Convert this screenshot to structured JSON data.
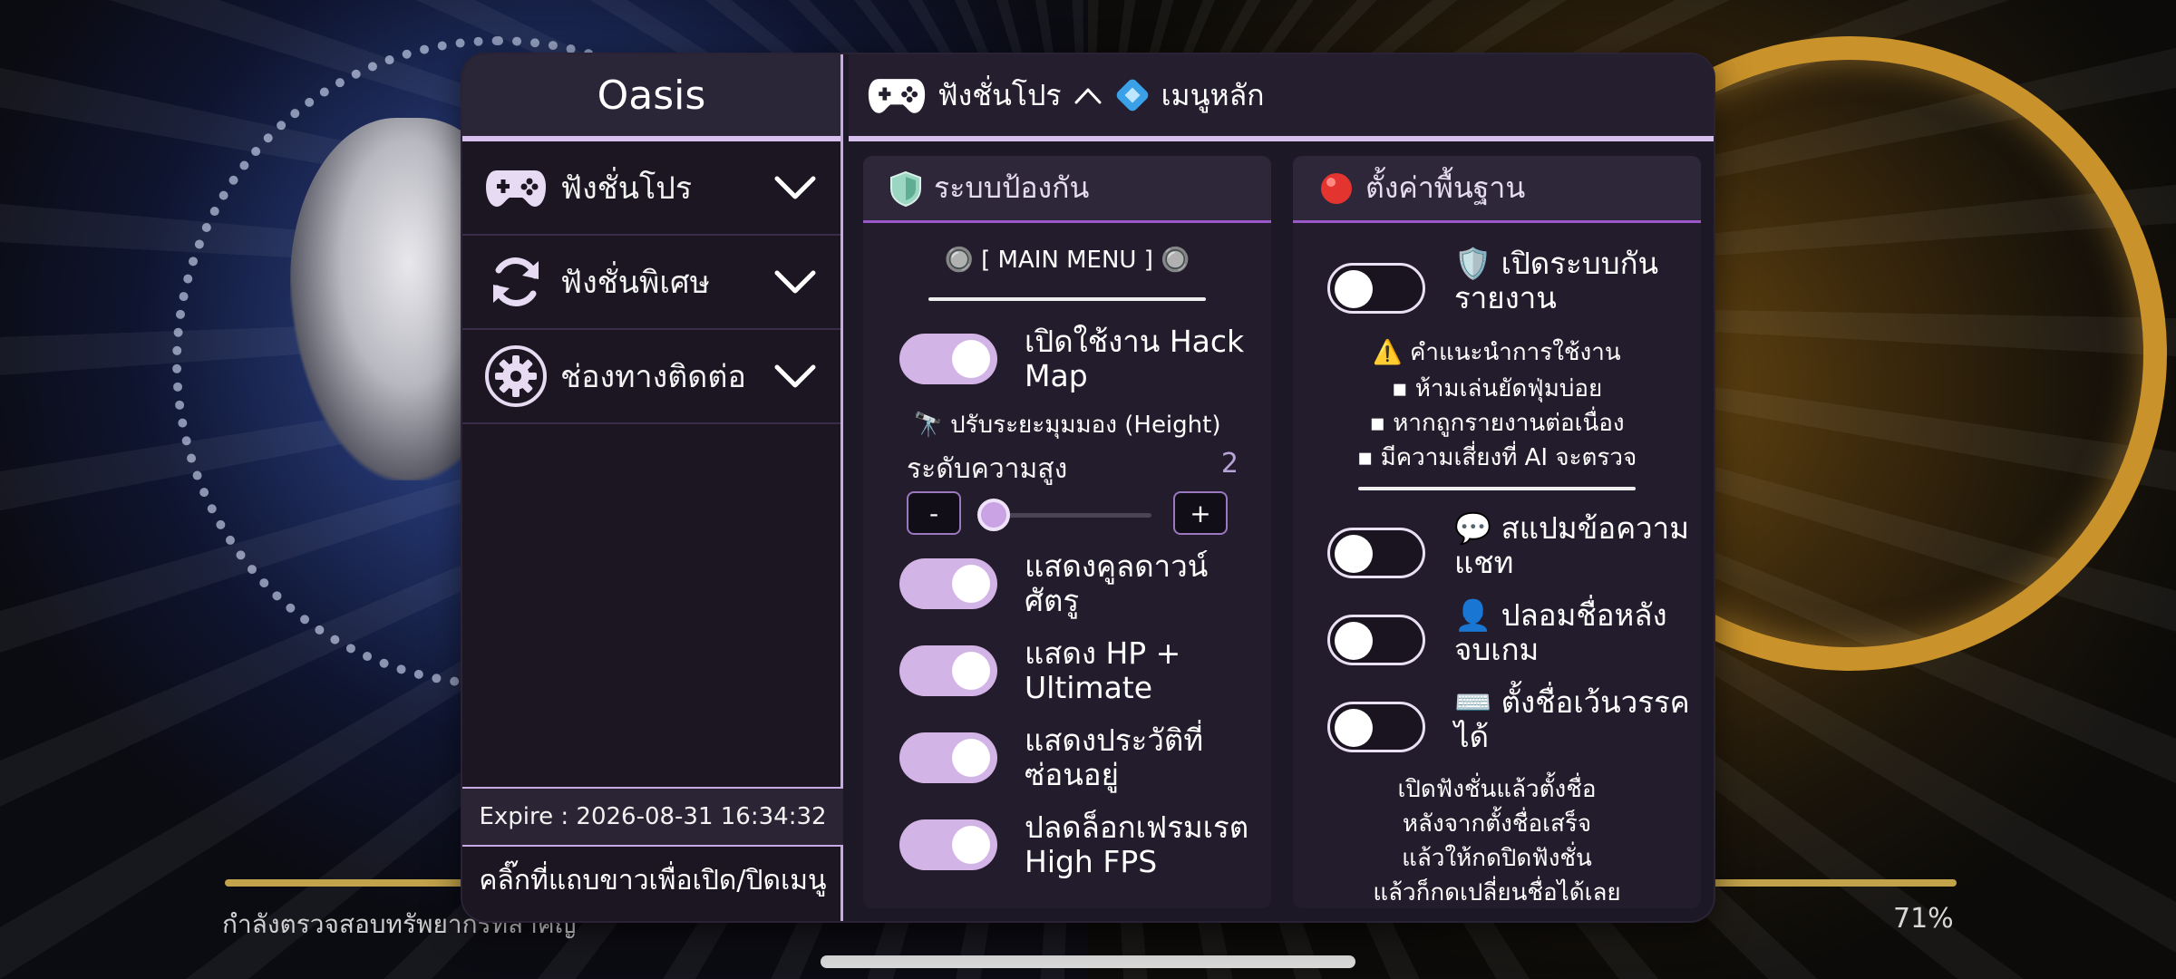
{
  "background": {
    "loading_text": "กำลังตรวจสอบทรัพยากรที่สำคัญ",
    "loading_percent": "71%"
  },
  "menu": {
    "title": "Oasis",
    "sidebar": {
      "items": [
        {
          "label": "ฟังชั่นโปร",
          "icon": "gamepad-icon"
        },
        {
          "label": "ฟังชั่นพิเศษ",
          "icon": "refresh-icon"
        },
        {
          "label": "ช่องทางติดต่อ",
          "icon": "gear-icon"
        }
      ],
      "expire": "Expire : 2026-08-31 16:34:32",
      "toggle_hint": "คลิ๊กที่แถบขาวเพื่อเปิด/ปิดเมนู"
    },
    "breadcrumb": {
      "section": "ฟังชั่นโปร",
      "page": "เมนูหลัก"
    },
    "left_panel": {
      "title": "ระบบป้องกัน",
      "main_menu_label": "🔘 [ MAIN MENU ] 🔘",
      "hack_map": {
        "label": "เปิดใช้งาน Hack Map",
        "on": true
      },
      "height_note": "🔭 ปรับระยะมุมมอง (Height)",
      "height_label": "ระดับความสูง",
      "height_value": "2",
      "minus": "-",
      "plus": "+",
      "options": [
        {
          "label": "แสดงคูลดาวน์ศัตรู",
          "on": true
        },
        {
          "label": "แสดง HP + Ultimate",
          "on": true
        },
        {
          "label": "แสดงประวัติที่ซ่อนอยู่",
          "on": true
        },
        {
          "label": "ปลดล็อกเฟรมเรต High FPS",
          "on": true
        }
      ]
    },
    "right_panel": {
      "title": "ตั้งค่าพื้นฐาน",
      "anti_report": {
        "label": "🛡️ เปิดระบบกันรายงาน",
        "on": false
      },
      "usage_title": "⚠️ คำแนะนำการใช้งาน",
      "usage_tips": [
        "▪ ห้ามเล่นยัดฟุ่มบ่อย",
        "▪ หากถูกรายงานต่อเนื่อง",
        "▪ มีความเสี่ยงที่ AI จะตรวจ"
      ],
      "options": [
        {
          "label": "💬 สแปมข้อความแชท",
          "on": false
        },
        {
          "label": "👤 ปลอมชื่อหลังจบเกม",
          "on": false
        },
        {
          "label": "⌨️ ตั้งชื่อเว้นวรรคได้",
          "on": false
        }
      ],
      "rename_notes": [
        "เปิดฟังชั่นแล้วตั้งชื่อ",
        "หลังจากตั้งชื่อเสร็จ",
        "แล้วให้กดปิดฟังชั่น",
        "แล้วก็กดเปลี่ยนชื่อได้เลย"
      ]
    }
  },
  "colors": {
    "accent": "#d2b5e6",
    "panel_bg": "#231c2c",
    "header_border": "#9a58c9"
  }
}
